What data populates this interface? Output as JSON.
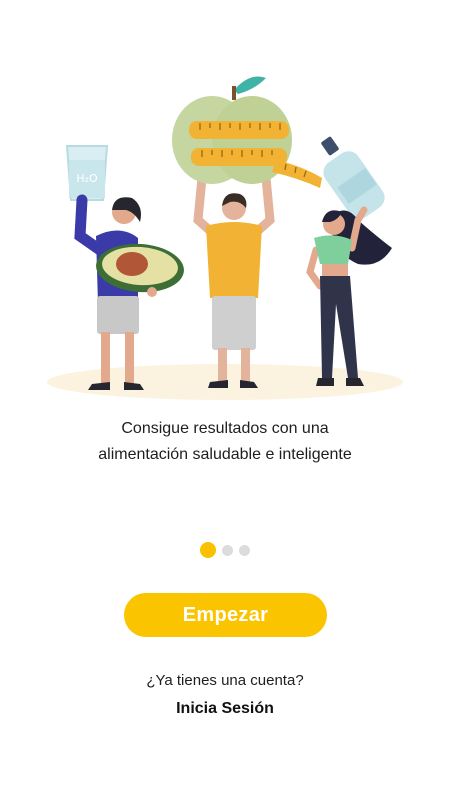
{
  "onboarding": {
    "caption_line1": "Consigue resultados con una",
    "caption_line2": "alimentación saludable e inteligente",
    "page_indicator": {
      "current": 1,
      "total": 3
    },
    "illustration": {
      "icon": "people-healthy-food-illustration",
      "glass_label": "H₂O"
    }
  },
  "actions": {
    "start_label": "Empezar",
    "account_question": "¿Ya tienes una cuenta?",
    "login_label": "Inicia Sesión"
  },
  "colors": {
    "accent": "#fbc400",
    "inactive_dot": "#dcdcdc",
    "background": "#ffffff"
  }
}
